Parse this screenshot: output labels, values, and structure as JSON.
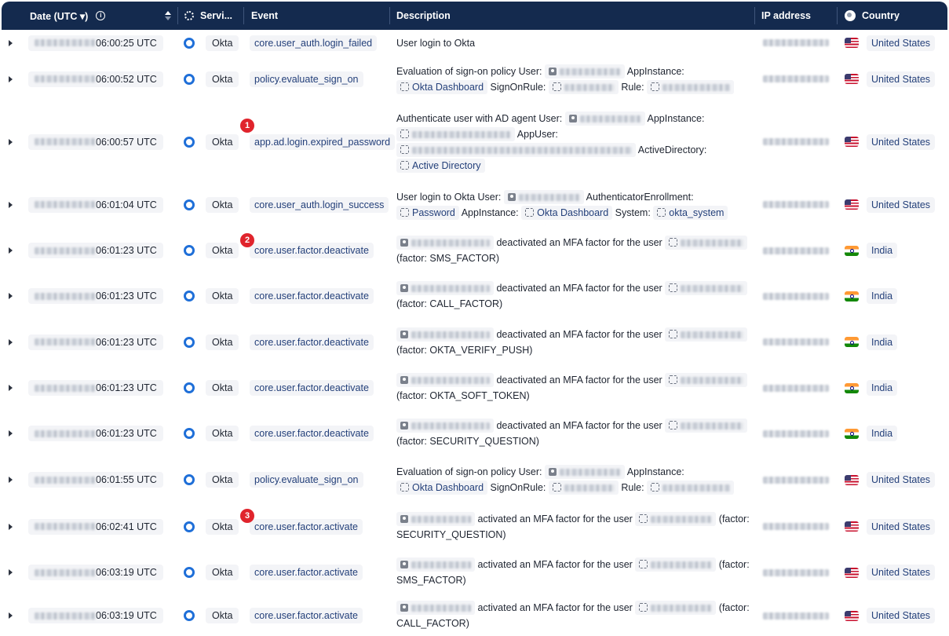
{
  "header": {
    "date": "Date (UTC ▾)",
    "info_glyph": "i",
    "service": "Servi...",
    "event": "Event",
    "description": "Description",
    "ip": "IP address",
    "country": "Country"
  },
  "icons": {
    "okta": "okta-icon",
    "user": "user-icon",
    "app": "app-instance-icon",
    "flag_us": "us-flag-icon",
    "flag_in": "india-flag-icon"
  },
  "rows": [
    {
      "time": "06:00:25 UTC",
      "service": "Okta",
      "event": "core.user_auth.login_failed",
      "country": "United States",
      "flag": "us"
    },
    {
      "time": "06:00:52 UTC",
      "service": "Okta",
      "event": "policy.evaluate_sign_on",
      "country": "United States",
      "flag": "us"
    },
    {
      "time": "06:00:57 UTC",
      "service": "Okta",
      "event": "app.ad.login.expired_password",
      "country": "United States",
      "flag": "us",
      "marker": "1"
    },
    {
      "time": "06:01:04 UTC",
      "service": "Okta",
      "event": "core.user_auth.login_success",
      "country": "United States",
      "flag": "us"
    },
    {
      "time": "06:01:23 UTC",
      "service": "Okta",
      "event": "core.user.factor.deactivate",
      "country": "India",
      "flag": "in",
      "marker": "2"
    },
    {
      "time": "06:01:23 UTC",
      "service": "Okta",
      "event": "core.user.factor.deactivate",
      "country": "India",
      "flag": "in"
    },
    {
      "time": "06:01:23 UTC",
      "service": "Okta",
      "event": "core.user.factor.deactivate",
      "country": "India",
      "flag": "in"
    },
    {
      "time": "06:01:23 UTC",
      "service": "Okta",
      "event": "core.user.factor.deactivate",
      "country": "India",
      "flag": "in"
    },
    {
      "time": "06:01:23 UTC",
      "service": "Okta",
      "event": "core.user.factor.deactivate",
      "country": "India",
      "flag": "in"
    },
    {
      "time": "06:01:55 UTC",
      "service": "Okta",
      "event": "policy.evaluate_sign_on",
      "country": "United States",
      "flag": "us"
    },
    {
      "time": "06:02:41 UTC",
      "service": "Okta",
      "event": "core.user.factor.activate",
      "country": "United States",
      "flag": "us",
      "marker": "3"
    },
    {
      "time": "06:03:19 UTC",
      "service": "Okta",
      "event": "core.user.factor.activate",
      "country": "United States",
      "flag": "us"
    },
    {
      "time": "06:03:19 UTC",
      "service": "Okta",
      "event": "core.user.factor.activate",
      "country": "United States",
      "flag": "us"
    }
  ],
  "desc": {
    "r0": {
      "t1": "User login to Okta"
    },
    "r1": {
      "t1": "Evaluation of sign-on policy User:",
      "t2": "AppInstance:",
      "e1": "Okta Dashboard",
      "t3": "SignOnRule:",
      "t4": "Rule:"
    },
    "r2": {
      "t1": "Authenticate user with AD agent User:",
      "t2": "AppInstance:",
      "t3": "AppUser:",
      "t4": "ActiveDirectory:",
      "e1": "Active Directory"
    },
    "r3": {
      "t1": "Authenticate user with AD agent User:",
      "t2": "AuthenticatorEnrollment:",
      "e1": "Password",
      "t3": "AppInstance:",
      "e2": "Okta Dashboard",
      "t4": "System:",
      "e3": "okta_system"
    },
    "r3_first": "User login to Okta User:",
    "deact": "deactivated an MFA factor for the user",
    "act": "activated an MFA factor for the user",
    "f4": "(factor: SMS_FACTOR)",
    "f5": "(factor: CALL_FACTOR)",
    "f6": "(factor: OKTA_VERIFY_PUSH)",
    "f7": "(factor: OKTA_SOFT_TOKEN)",
    "f8": "(factor: SECURITY_QUESTION)",
    "r9": {
      "t1": "Evaluation of sign-on policy User:",
      "t2": "AppInstance:",
      "e1": "Okta Dashboard",
      "t3": "SignOnRule:",
      "t4": "Rule:"
    },
    "fa": "(factor:",
    "f10": "SECURITY_QUESTION)",
    "f11": "SMS_FACTOR)",
    "f12": "CALL_FACTOR)"
  }
}
